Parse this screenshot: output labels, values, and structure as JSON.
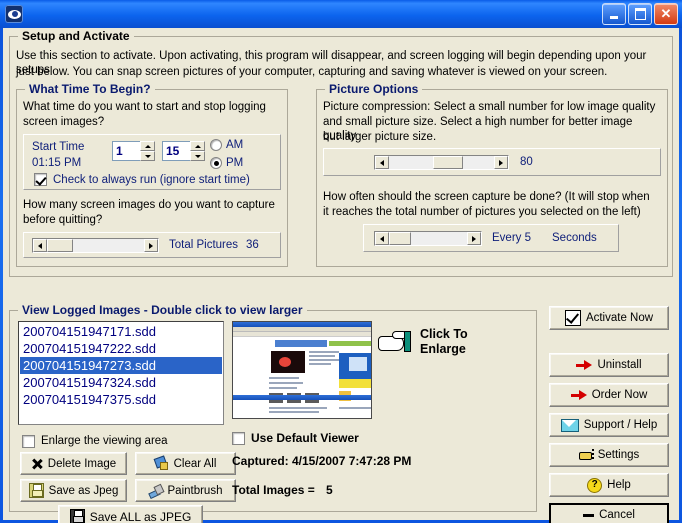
{
  "window": {
    "title": "",
    "icon": "eye-icon",
    "buttons": {
      "minimize": "_",
      "maximize": "□",
      "close": "✕"
    }
  },
  "setup_group": {
    "title": "Setup and Activate",
    "description_line1": "Use this section to activate. Upon activating, this program will disappear, and screen logging will begin depending upon your setups",
    "description_line2": "just below. You can snap screen pictures of your computer, capturing and saving whatever is viewed on your screen."
  },
  "time_group": {
    "title": "What Time To Begin?",
    "question_line1": "What time do you want to start and stop logging",
    "question_line2": "screen images?",
    "start_time_label": "Start Time",
    "start_time_value": "01:15 PM",
    "hour_value": "1",
    "minute_value": "15",
    "am_label": "AM",
    "pm_label": "PM",
    "am_selected": false,
    "pm_selected": true,
    "always_run_label": "Check to always run (ignore start time)",
    "always_run_checked": true,
    "capture_question_line1": "How many screen images do you want to capture",
    "capture_question_line2": "before quitting?",
    "total_pictures_label": "Total Pictures",
    "total_pictures_value": "36"
  },
  "picture_group": {
    "title": "Picture Options",
    "compression_line1": "Picture compression: Select a small number for low image quality",
    "compression_line2": "and small picture size. Select a high number for better image quality",
    "compression_line3": "but larger picture size.",
    "compression_value": "80",
    "frequency_line1": "How often should the screen capture be done? (It will stop when",
    "frequency_line2": "it reaches the total number of pictures you selected on the left)",
    "every_label": "Every 5",
    "seconds_label": "Seconds"
  },
  "logged_group": {
    "title": "View Logged Images - Double click to view larger",
    "files": [
      {
        "name": "200704151947171.sdd",
        "selected": false
      },
      {
        "name": "200704151947222.sdd",
        "selected": false
      },
      {
        "name": "200704151947273.sdd",
        "selected": true
      },
      {
        "name": "200704151947324.sdd",
        "selected": false
      },
      {
        "name": "200704151947375.sdd",
        "selected": false
      }
    ],
    "enlarge_label": "Enlarge the viewing area",
    "enlarge_checked": false,
    "delete_label": "Delete Image",
    "clear_all_label": "Clear All",
    "save_jpeg_label": "Save as Jpeg",
    "paintbrush_label": "Paintbrush",
    "save_all_label": "Save ALL as JPEG"
  },
  "preview": {
    "click_enlarge_line1": "Click To",
    "click_enlarge_line2": "Enlarge",
    "use_default_viewer_label": "Use Default Viewer",
    "use_default_viewer_checked": false,
    "captured_label": "Captured: 4/15/2007 7:47:28 PM",
    "total_images_label": "Total Images =",
    "total_images_value": "5"
  },
  "actions": {
    "activate": "Activate Now",
    "uninstall": "Uninstall",
    "order": "Order Now",
    "support": "Support / Help",
    "settings": "Settings",
    "help": "Help",
    "cancel": "Cancel"
  },
  "colors": {
    "titlebar": "#0c64ee",
    "face": "#ece9d8",
    "label_blue": "#10207a",
    "selection": "#2a64c8",
    "accent_red": "#d40000"
  }
}
